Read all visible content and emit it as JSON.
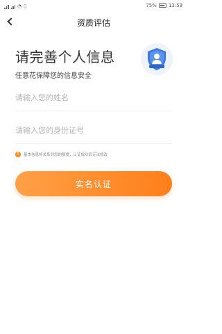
{
  "status_bar": {
    "battery": "75%",
    "time": "13:59"
  },
  "nav": {
    "title": "资质评估"
  },
  "main": {
    "headline": "请完善个人信息",
    "subline": "任意花保障您的信息安全",
    "badge_icon": "shield-user-icon",
    "name_field": {
      "placeholder": "请输入您的姓名",
      "value": ""
    },
    "id_field": {
      "placeholder": "请输入您的身份证号",
      "value": ""
    },
    "tip": "基本信息将关系到您的额度，认证成功后无法修改",
    "submit_label": "实名认证"
  },
  "colors": {
    "accent": "#ff8a2a",
    "badge_blue": "#3d7be0"
  }
}
